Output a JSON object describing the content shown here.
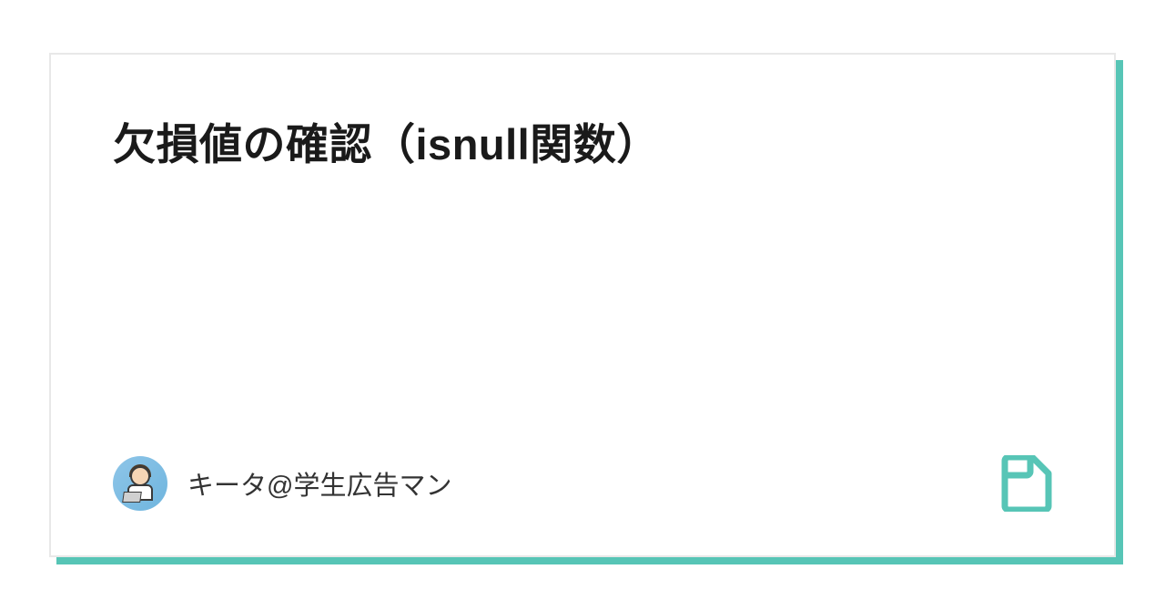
{
  "card": {
    "title": "欠損値の確認（isnull関数）",
    "author": {
      "name": "キータ@学生広告マン"
    }
  },
  "colors": {
    "accent": "#57c5b6",
    "text": "#1a1a1a"
  }
}
